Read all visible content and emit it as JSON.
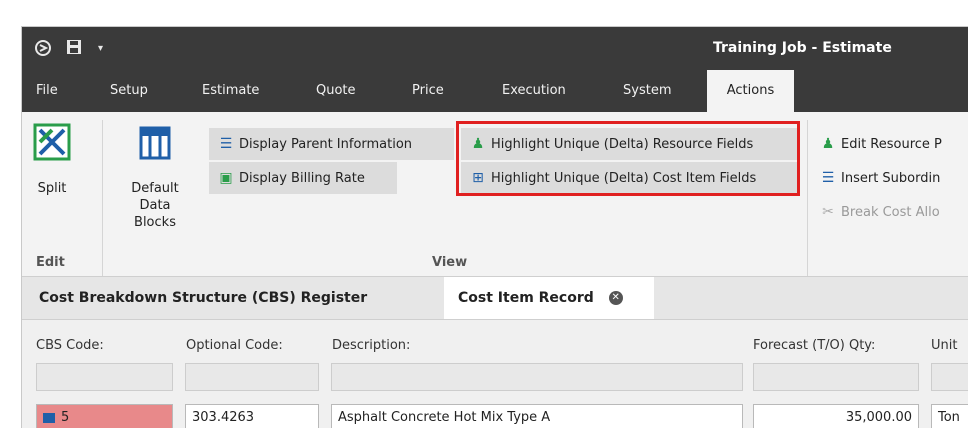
{
  "window": {
    "title": "Training Job - Estimate"
  },
  "menu": {
    "items": [
      {
        "label": "File"
      },
      {
        "label": "Setup"
      },
      {
        "label": "Estimate"
      },
      {
        "label": "Quote"
      },
      {
        "label": "Price"
      },
      {
        "label": "Execution"
      },
      {
        "label": "System"
      },
      {
        "label": "Actions"
      }
    ],
    "active": "Actions"
  },
  "ribbon": {
    "edit_group": {
      "label": "Edit",
      "split_label": "Split"
    },
    "default_data_blocks_label": "Default Data Blocks",
    "view_group": {
      "label": "View",
      "display_parent_information": "Display Parent Information",
      "display_billing_rate": "Display Billing Rate",
      "highlight_resource_fields": "Highlight Unique (Delta) Resource Fields",
      "highlight_cost_item_fields": "Highlight Unique (Delta) Cost Item Fields"
    },
    "right_group": {
      "edit_resource": "Edit Resource P",
      "insert_subordinate": "Insert Subordin",
      "break_cost": "Break Cost Allo"
    },
    "highlight_color": "#e02020"
  },
  "tabs": [
    {
      "label": "Cost Breakdown Structure (CBS) Register"
    },
    {
      "label": "Cost Item Record"
    }
  ],
  "fields": {
    "cbs_code_label": "CBS Code:",
    "optional_code_label": "Optional Code:",
    "description_label": "Description:",
    "forecast_qty_label": "Forecast (T/O) Qty:",
    "unit_label": "Unit",
    "cbs_code_value": "5",
    "optional_code_value": "303.4263",
    "description_value": "Asphalt Concrete Hot Mix Type A",
    "forecast_qty_value": "35,000.00",
    "unit_value": "Ton"
  }
}
